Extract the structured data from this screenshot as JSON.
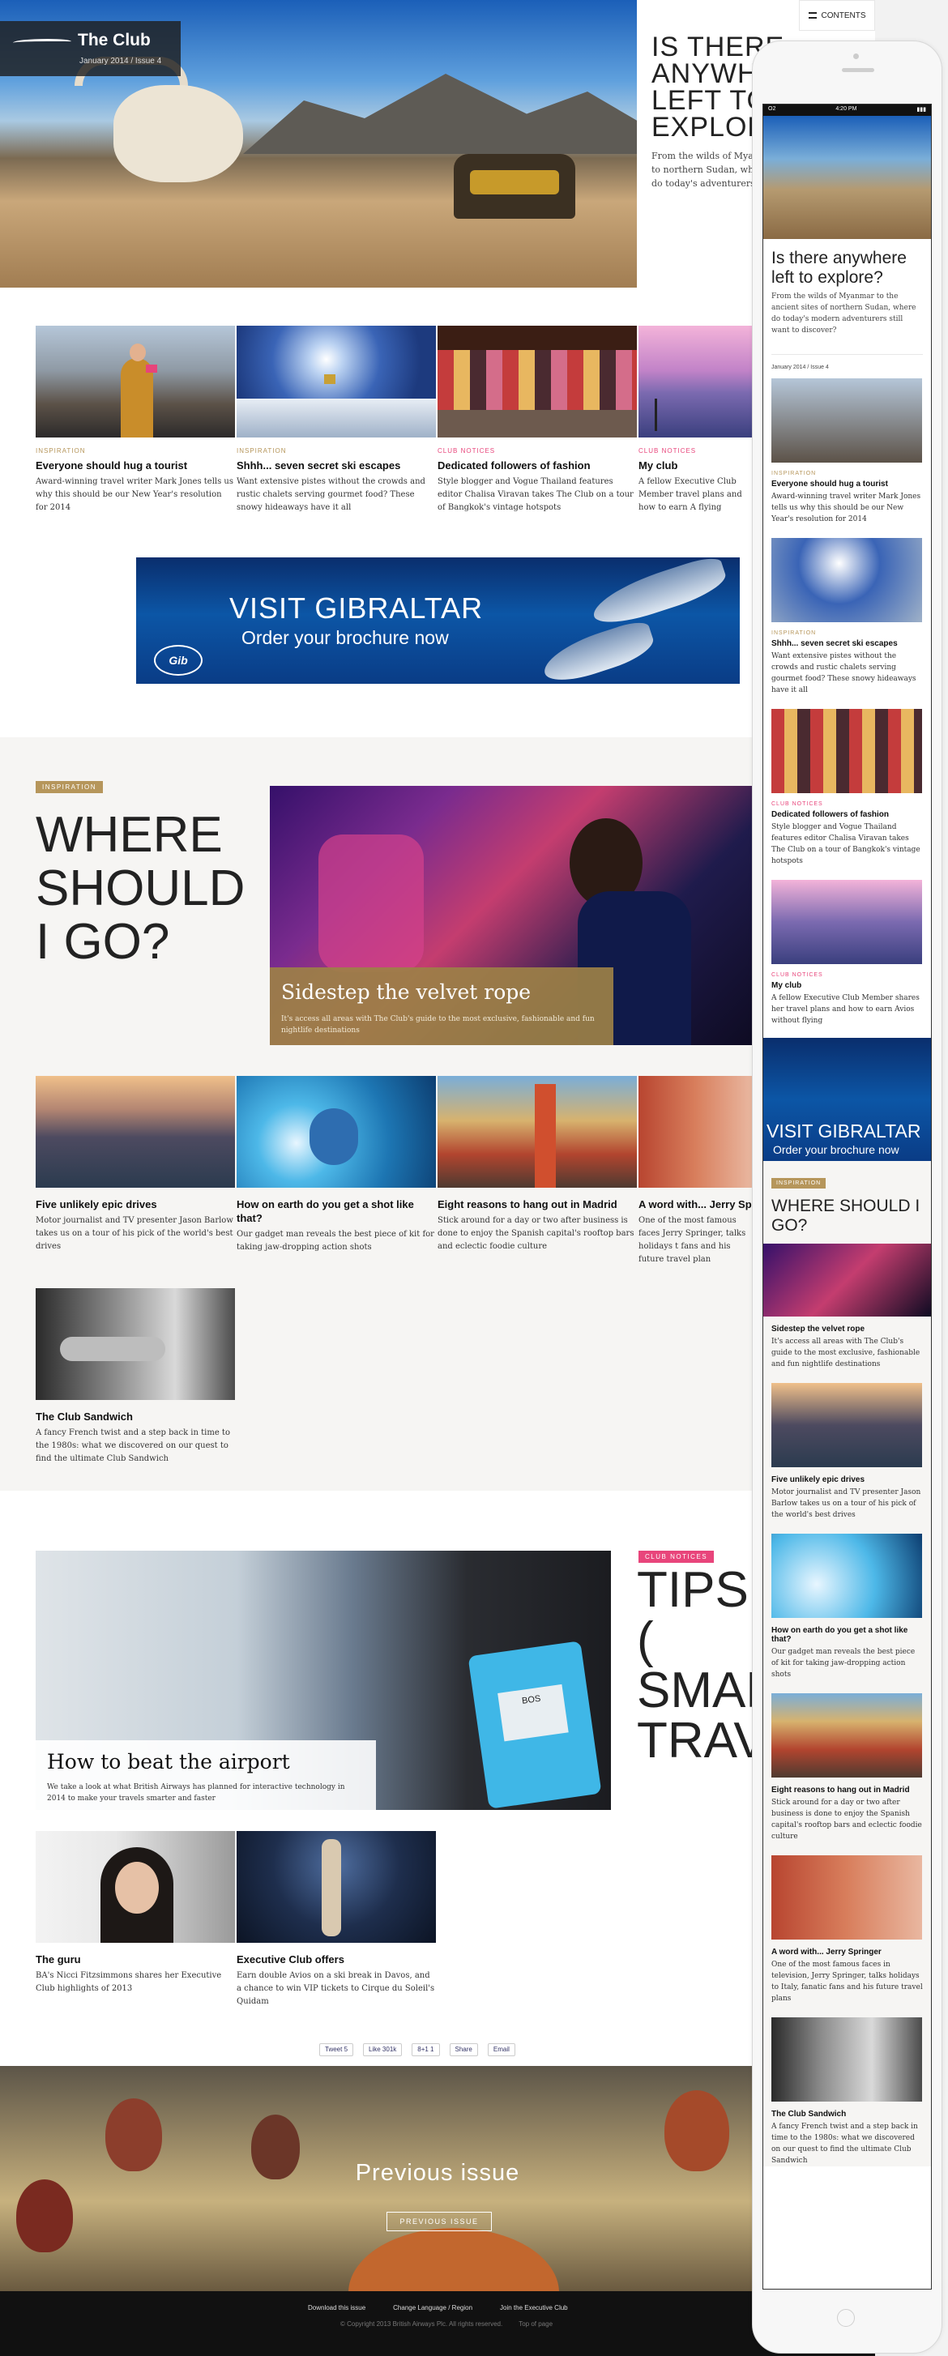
{
  "masthead": {
    "brand": "The Club",
    "issue": "January 2014 / Issue 4",
    "contents": "CONTENTS"
  },
  "hero": {
    "title": "IS THERE\nANYWH\nLEFT TO\nEXPLOR",
    "text": "From the wilds of Myanmar to northern Sudan, where do today's adventurers still want to do"
  },
  "row1": [
    {
      "cat": "INSPIRATION",
      "title": "Everyone should hug a tourist",
      "desc": "Award-winning travel writer Mark Jones tells us why this should be our New Year's resolution for 2014"
    },
    {
      "cat": "INSPIRATION",
      "title": "Shhh... seven secret ski escapes",
      "desc": "Want extensive pistes without the crowds and rustic chalets serving gourmet food? These snowy hideaways have it all"
    },
    {
      "cat": "CLUB NOTICES",
      "title": "Dedicated followers of fashion",
      "desc": "Style blogger and Vogue Thailand features editor Chalisa Viravan takes The Club on a tour of Bangkok's vintage hotspots"
    },
    {
      "cat": "CLUB NOTICES",
      "title": "My club",
      "desc": "A fellow Executive Club Member travel plans and how to earn A flying"
    }
  ],
  "banner": {
    "line1": "VISIT GIBRALTAR",
    "line2": "Order your brochure now",
    "badge": "Gib"
  },
  "inspiration": {
    "tag": "INSPIRATION",
    "title": "WHERE\nSHOULD\nI GO?",
    "feature_title": "Sidestep the velvet rope",
    "feature_desc": "It's access all areas with The Club's guide to the most exclusive, fashionable and fun nightlife destinations"
  },
  "row2": [
    {
      "title": "Five unlikely epic drives",
      "desc": "Motor journalist and TV presenter Jason Barlow takes us on a tour of his pick of the world's best drives"
    },
    {
      "title": "How on earth do you get a shot like that?",
      "desc": "Our gadget man reveals the best piece of kit for taking jaw-dropping action shots"
    },
    {
      "title": "Eight reasons to hang out in Madrid",
      "desc": "Stick around for a day or two after business is done to enjoy the Spanish capital's rooftop bars and eclectic foodie culture"
    },
    {
      "title": "A word with... Jerry Sp",
      "desc": "One of the most famous faces Jerry Springer, talks holidays t fans and his future travel plan"
    },
    {
      "title": "The Club Sandwich",
      "desc": "A fancy French twist and a step back in time to the 1980s: what we discovered on our quest to find the ultimate Club Sandwich"
    }
  ],
  "tips": {
    "tag": "CLUB NOTICES",
    "title": "TIPS (\nSMAR\nTRAV",
    "feature_title": "How to beat the airport",
    "feature_desc": "We take a look at what British Airways has planned for interactive technology in 2014 to make your travels smarter and faster",
    "tag_label": "BOS"
  },
  "row3": [
    {
      "title": "The guru",
      "desc": "BA's Nicci Fitzsimmons shares her Executive Club highlights of 2013"
    },
    {
      "title": "Executive Club offers",
      "desc": "Earn double Avios on a ski break in Davos, and a chance to win VIP tickets to Cirque du Soleil's Quidam"
    }
  ],
  "share": [
    "Tweet 5",
    "Like 301k",
    "8+1 1",
    "Share",
    "Email"
  ],
  "prev": {
    "title": "Previous issue",
    "button": "PREVIOUS ISSUE"
  },
  "footer": {
    "links": [
      "Download this issue",
      "Change Language / Region",
      "Join the Executive Club"
    ],
    "legal": [
      "© Copyright 2013 British Airways Plc. All rights reserved.",
      "Top of page"
    ]
  },
  "mobile": {
    "status_left": "O2",
    "time": "4:20 PM",
    "title": "Is there anywhere left to explore?",
    "intro": "From the wilds of Myanmar to the ancient sites of northern Sudan, where do today's modern adventurers still want to discover?",
    "date": "January 2014 / Issue 4",
    "items": [
      {
        "cat": "INSPIRATION",
        "title": "Everyone should hug a tourist",
        "desc": "Award-winning travel writer Mark Jones tells us why this should be our New Year's resolution for 2014"
      },
      {
        "cat": "INSPIRATION",
        "title": "Shhh... seven secret ski escapes",
        "desc": "Want extensive pistes without the crowds and rustic chalets serving gourmet food? These snowy hideaways have it all"
      },
      {
        "cat": "CLUB NOTICES",
        "title": "Dedicated followers of fashion",
        "desc": "Style blogger and Vogue Thailand features editor Chalisa Viravan takes The Club on a tour of Bangkok's vintage hotspots"
      },
      {
        "cat": "CLUB NOTICES",
        "title": "My club",
        "desc": "A fellow Executive Club Member shares her travel plans and how to earn Avios without flying"
      }
    ],
    "banner1": "VISIT GIBRALTAR",
    "banner2": "Order your brochure now",
    "insp_tag": "INSPIRATION",
    "insp_title": "WHERE SHOULD I GO?",
    "items2": [
      {
        "title": "Sidestep the velvet rope",
        "desc": "It's access all areas with The Club's guide to the most exclusive, fashionable and fun nightlife destinations"
      },
      {
        "title": "Five unlikely epic drives",
        "desc": "Motor journalist and TV presenter Jason Barlow takes us on a tour of his pick of the world's best drives"
      },
      {
        "title": "How on earth do you get a shot like that?",
        "desc": "Our gadget man reveals the best piece of kit for taking jaw-dropping action shots"
      },
      {
        "title": "Eight reasons to hang out in Madrid",
        "desc": "Stick around for a day or two after business is done to enjoy the Spanish capital's rooftop bars and eclectic foodie culture"
      },
      {
        "title": "A word with... Jerry Springer",
        "desc": "One of the most famous faces in television, Jerry Springer, talks holidays to Italy, fanatic fans and his future travel plans"
      },
      {
        "title": "The Club Sandwich",
        "desc": "A fancy French twist and a step back in time to the 1980s: what we discovered on our quest to find the ultimate Club Sandwich"
      }
    ]
  }
}
